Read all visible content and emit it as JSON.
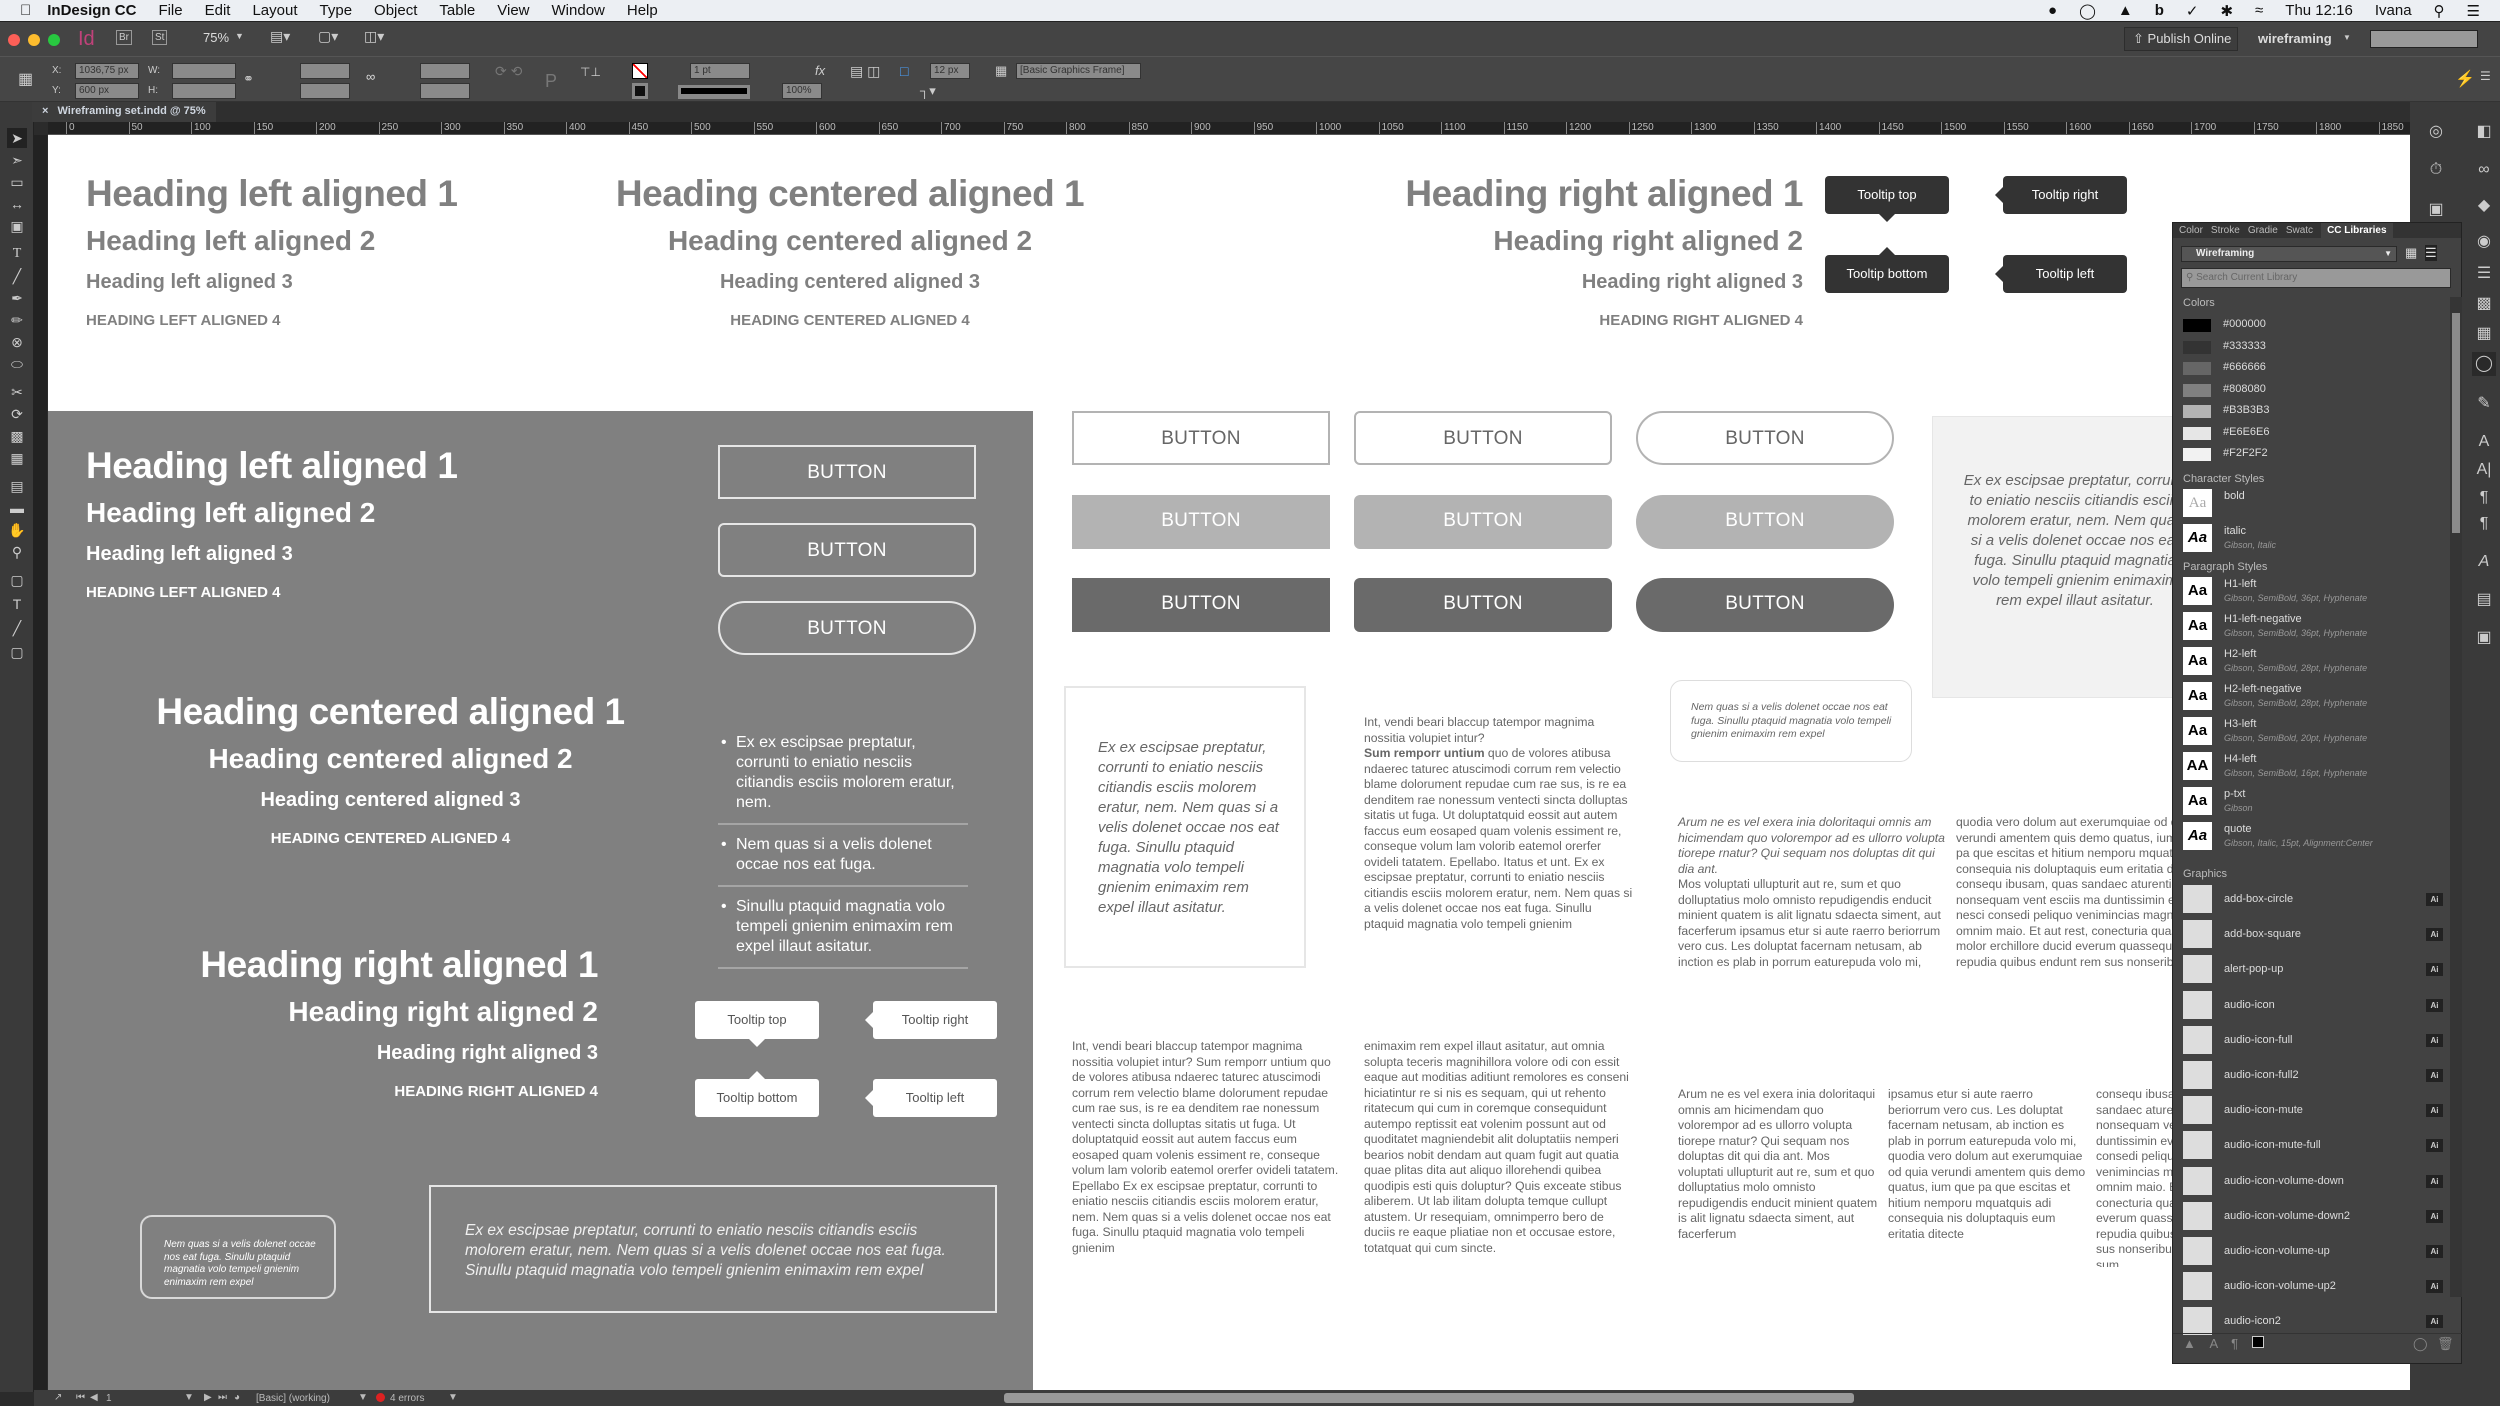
{
  "menubar": {
    "app_name": "InDesign CC",
    "items": [
      "File",
      "Edit",
      "Layout",
      "Type",
      "Object",
      "Table",
      "View",
      "Window",
      "Help"
    ],
    "clock": "Thu 12:16",
    "user": "Ivana"
  },
  "appbar": {
    "app_icon": "Id",
    "bridge": "Br",
    "stock": "St",
    "zoom": "75%",
    "publish_label": "Publish Online",
    "workspace": "wireframing",
    "search_placeholder": ""
  },
  "control": {
    "x_label": "X:",
    "x_value": "1036,75 px",
    "y_label": "Y:",
    "y_value": "600 px",
    "w_label": "W:",
    "h_label": "H:",
    "stroke_weight": "1 pt",
    "opacity": "100%",
    "corner_size": "12 px",
    "object_style": "[Basic Graphics Frame]"
  },
  "document": {
    "tab_title": "Wireframing set.indd @ 75%",
    "ruler_ticks": [
      "0",
      "50",
      "100",
      "150",
      "200",
      "250",
      "300",
      "350",
      "400",
      "450",
      "500",
      "550",
      "600",
      "650",
      "700",
      "750",
      "800",
      "850",
      "900",
      "950",
      "1000",
      "1050",
      "1100",
      "1150",
      "1200",
      "1250",
      "1300",
      "1350",
      "1400",
      "1450",
      "1500",
      "1550",
      "1600",
      "1650",
      "1700",
      "1750",
      "1800",
      "1850"
    ]
  },
  "canvas": {
    "headings_top": {
      "left": [
        "Heading left aligned 1",
        "Heading left aligned 2",
        "Heading left aligned 3",
        "HEADING LEFT ALIGNED 4"
      ],
      "center": [
        "Heading centered aligned 1",
        "Heading centered aligned 2",
        "Heading centered aligned 3",
        "HEADING CENTERED ALIGNED 4"
      ],
      "right": [
        "Heading right aligned 1",
        "Heading right aligned 2",
        "Heading right aligned 3",
        "HEADING RIGHT ALIGNED 4"
      ]
    },
    "tooltips": {
      "top": "Tooltip top",
      "right": "Tooltip right",
      "bottom": "Tooltip bottom",
      "left": "Tooltip left"
    },
    "button_label": "BUTTON",
    "dark_panel": {
      "left": [
        "Heading left aligned 1",
        "Heading left aligned 2",
        "Heading left aligned 3",
        "HEADING LEFT ALIGNED 4"
      ],
      "center": [
        "Heading centered aligned 1",
        "Heading centered aligned 2",
        "Heading centered aligned 3",
        "HEADING CENTERED ALIGNED 4"
      ],
      "right": [
        "Heading right aligned 1",
        "Heading right aligned 2",
        "Heading right aligned 3",
        "HEADING RIGHT ALIGNED 4"
      ],
      "bullets": [
        "Ex ex escipsae preptatur, corrunti to eniatio nesciis citiandis esciis molorem eratur, nem.",
        "Nem quas si a velis dolenet occae nos eat fuga.",
        "Sinullu ptaquid magnatia volo tempeli gnienim enimaxim rem expel illaut asitatur."
      ],
      "small_card": "Nem quas si a velis dolenet occae nos eat fuga. Sinullu ptaquid magnatia volo tempeli gnienim enimaxim rem expel",
      "quote_box": "Ex ex escipsae preptatur, corrunti to eniatio nesciis citiandis esciis molorem eratur, nem. Nem quas si a velis dolenet occae nos eat fuga. Sinullu ptaquid magnatia volo tempeli gnienim enimaxim rem expel"
    },
    "quote_card": "Ex ex escipsae preptatur, corrunti to eniatio nesciis citiandis esciis molorem eratur, nem. Nem quas si a velis dolenet occae nos eat fuga. Sinullu ptaquid magnatia volo tempeli gnienim enimaxim rem expel illaut asitatur.",
    "gray_quote": "Ex ex escipsae preptatur, corrunti to eniatio nesciis citiandis esciis molorem eratur, nem. Nem quas si a velis dolenet occae nos eat fuga. Sinullu ptaquid magnatia volo tempeli gnienim enimaxim rem expel illaut asitatur.",
    "small_card": "Nem quas si a velis dolenet occae nos eat fuga. Sinullu ptaquid magnatia volo tempeli gnienim enimaxim rem expel",
    "text_a_intro": "Int, vendi beari blaccup tatempor magnima nossitia volupiet intur?",
    "text_a_bold": "Sum remporr untium",
    "text_a_rest": " quo de volores atibusa ndaerec taturec atuscimodi corrum rem velectio blame dolorument repudae cum rae sus, is re ea denditem rae nonessum ventecti sincta dolluptas sitatis ut fuga. Ut doluptatquid eossit aut autem faccus eum eosaped quam volenis essiment re, conseque volum lam volorib eatemol orerfer ovideli tatatem. Epellabo. Itatus et unt. Ex ex escipsae preptatur, corrunti to eniatio nesciis citiandis esciis molorem eratur, nem. Nem quas si a velis dolenet occae nos eat fuga. Sinullu ptaquid magnatia volo tempeli gnienim",
    "text_b_italic": "Arum ne es vel exera inia doloritaqui omnis am hicimendam quo volorempor ad es ullorro volupta tiorepe rnatur? Qui sequam nos doluptas dit qui dia ant.",
    "text_b_rest": "Mos voluptati ullupturit aut re, sum et quo dolluptatius molo omnisto repudigendis enducit minient quatem is alit lignatu sdaecta siment, aut facerferum ipsamus etur si aute raerro beriorrum vero cus. Les doluptat facernam netusam, ab inction es plab in porrum eaturepuda volo mi,",
    "text_c": "quodia vero dolum aut exerumquiae od quia verundi amentem quis demo quatus, ium que pa que escitas et hitium nemporu mquatquis adi consequia nis doluptaquis eum eritatia ditecte consequ ibusam, quas sandaec aturention nonsequam vent esciis ma duntissimin evelitiae nesci consedi peliquo venimincias magnim aci omnim maio. Et aut rest, conecturia quas as molor erchillore ducid everum quassequi dem repudia quibus endunt rem sus nonseribus",
    "col1": "Int, vendi beari blaccup tatempor magnima nossitia volupiet intur? Sum remporr untium quo de volores atibusa ndaerec taturec atuscimodi corrum rem velectio blame dolorument repudae cum rae sus, is re ea denditem rae nonessum ventecti sincta dolluptas sitatis ut fuga. Ut doluptatquid eossit aut autem faccus eum eosaped quam volenis essiment re, conseque volum lam volorib eatemol orerfer ovideli tatatem. Epellabo Ex ex escipsae preptatur, corrunti to eniatio nesciis citiandis esciis molorem eratur, nem. Nem quas si a velis dolenet occae nos eat fuga. Sinullu ptaquid magnatia volo tempeli gnienim",
    "col2": "enimaxim rem expel illaut asitatur, aut omnia solupta teceris magnihillora volore odi con essit eaque aut moditias aditiunt remolores es conseni hiciatintur re si nis es sequam, qui ut rehento ritatecum qui cum in coremque consequidunt autempo reptissit eat volenim possunt aut od quoditatet magniendebit alit doluptatiis nemperi bearios nobit dendam aut quam fugit aut quatia quae plitas dita aut aliquo illorehendi quibea quodipis esti quis doluptur? Quis exceate stibus aliberem. Ut lab ilitam dolupta temque cullupt atustem. Ur resequiam, omnimperro bero de duciis re eaque pliatiae non et occusae estore, totatquat qui cum sincte.",
    "col3": "Arum ne es vel exera inia doloritaqui omnis am hicimendam quo volorempor ad es ullorro volupta tiorepe rnatur? Qui sequam nos doluptas dit qui dia ant. Mos voluptati ullupturit aut re, sum et quo dolluptatius molo omnisto repudigendis enducit minient quatem is alit lignatu sdaecta siment, aut facerferum",
    "col4": "ipsamus etur si aute raerro beriorrum vero cus. Les doluptat facernam netusam, ab inction es plab in porrum eaturepuda volo mi, quodia vero dolum aut exerumquiae od quia verundi amentem quis demo quatus, ium que pa que escitas et hitium nemporu mquatquis adi consequia nis doluptaquis eum eritatia ditecte",
    "col5": "consequ ibusam, quas sandaec aturention nonsequam vent esciis ma duntissimin evelitiae nesci consedi peliquo venimincias magnim aci omnim maio. Et aut rest, conecturia quas as molor everum quassequi dem repudia quibus endunt rem sus nonseribus dellam illor sum"
  },
  "cc_libraries": {
    "tabs": [
      "Color",
      "Stroke",
      "Gradie",
      "Swatc",
      "CC Libraries"
    ],
    "library": "Wireframing",
    "search_placeholder": "Search Current Library",
    "colors_header": "Colors",
    "colors": [
      {
        "label": "#000000",
        "hex": "#000000"
      },
      {
        "label": "#333333",
        "hex": "#333333"
      },
      {
        "label": "#666666",
        "hex": "#666666"
      },
      {
        "label": "#808080",
        "hex": "#808080"
      },
      {
        "label": "#B3B3B3",
        "hex": "#B3B3B3"
      },
      {
        "label": "#E6E6E6",
        "hex": "#E6E6E6"
      },
      {
        "label": "#F2F2F2",
        "hex": "#F2F2F2"
      }
    ],
    "char_styles_header": "Character Styles",
    "char_styles": [
      {
        "name": "bold",
        "desc": "",
        "thumb": "Aa"
      },
      {
        "name": "italic",
        "desc": "Gibson, Italic",
        "thumb": "Aa"
      }
    ],
    "para_styles_header": "Paragraph Styles",
    "para_styles": [
      {
        "name": "H1-left",
        "desc": "Gibson, SemiBold, 36pt, Hyphenate",
        "thumb": "Aa"
      },
      {
        "name": "H1-left-negative",
        "desc": "Gibson, SemiBold, 36pt, Hyphenate",
        "thumb": "Aa"
      },
      {
        "name": "H2-left",
        "desc": "Gibson, SemiBold, 28pt, Hyphenate",
        "thumb": "Aa"
      },
      {
        "name": "H2-left-negative",
        "desc": "Gibson, SemiBold, 28pt, Hyphenate",
        "thumb": "Aa"
      },
      {
        "name": "H3-left",
        "desc": "Gibson, SemiBold, 20pt, Hyphenate",
        "thumb": "Aa"
      },
      {
        "name": "H4-left",
        "desc": "Gibson, SemiBold, 16pt, Hyphenate",
        "thumb": "AA"
      },
      {
        "name": "p-txt",
        "desc": "Gibson",
        "thumb": "Aa"
      },
      {
        "name": "quote",
        "desc": "Gibson, Italic, 15pt, Alignment:Center",
        "thumb": "Aa"
      }
    ],
    "graphics_header": "Graphics",
    "graphics": [
      "add-box-circle",
      "add-box-square",
      "alert-pop-up",
      "audio-icon",
      "audio-icon-full",
      "audio-icon-full2",
      "audio-icon-mute",
      "audio-icon-mute-full",
      "audio-icon-volume-down",
      "audio-icon-volume-down2",
      "audio-icon-volume-up",
      "audio-icon-volume-up2",
      "audio-icon2"
    ],
    "graphic_badge": "Ai"
  },
  "status": {
    "page": "1",
    "preflight_profile": "[Basic] (working)",
    "errors": "4 errors"
  }
}
